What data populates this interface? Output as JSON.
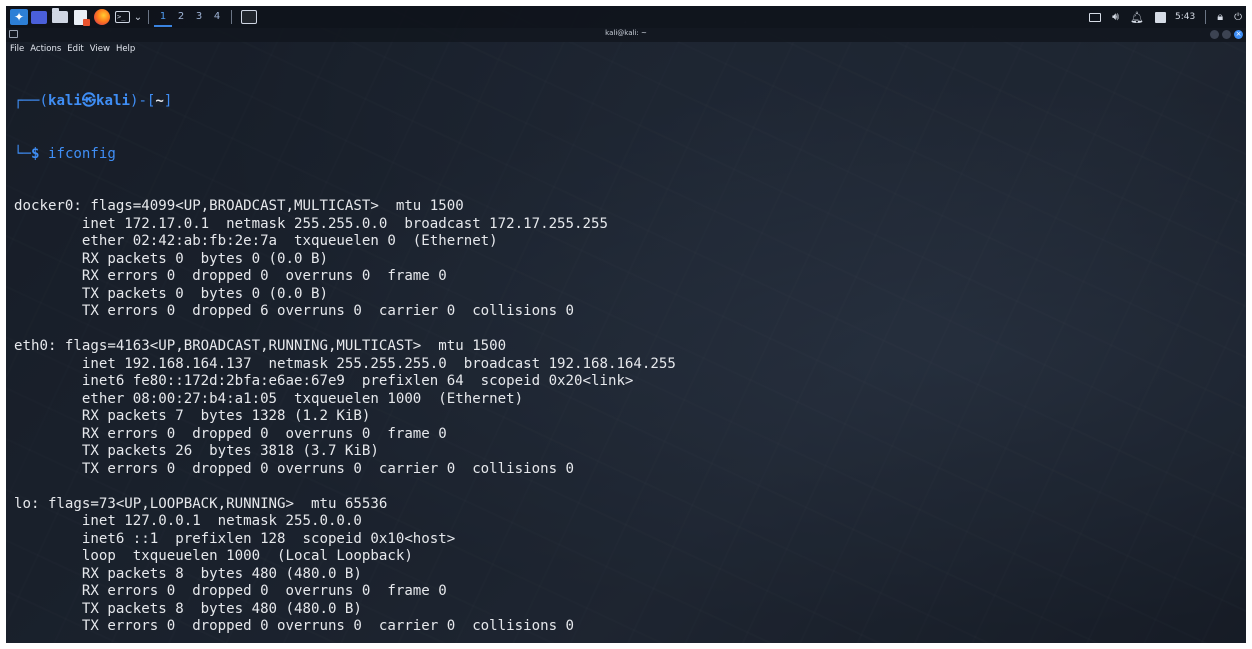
{
  "panel": {
    "workspaces": [
      {
        "label": "1",
        "active": true
      },
      {
        "label": "2",
        "active": false
      },
      {
        "label": "3",
        "active": false
      },
      {
        "label": "4",
        "active": false
      }
    ],
    "clock": "5:43"
  },
  "window": {
    "title": "kali@kali: ~",
    "menu": [
      "File",
      "Actions",
      "Edit",
      "View",
      "Help"
    ]
  },
  "prompt": {
    "user": "kali",
    "host": "kali",
    "dir": "~",
    "command": "ifconfig"
  },
  "output_lines": [
    "docker0: flags=4099<UP,BROADCAST,MULTICAST>  mtu 1500",
    "        inet 172.17.0.1  netmask 255.255.0.0  broadcast 172.17.255.255",
    "        ether 02:42:ab:fb:2e:7a  txqueuelen 0  (Ethernet)",
    "        RX packets 0  bytes 0 (0.0 B)",
    "        RX errors 0  dropped 0  overruns 0  frame 0",
    "        TX packets 0  bytes 0 (0.0 B)",
    "        TX errors 0  dropped 6 overruns 0  carrier 0  collisions 0",
    "",
    "eth0: flags=4163<UP,BROADCAST,RUNNING,MULTICAST>  mtu 1500",
    "        inet 192.168.164.137  netmask 255.255.255.0  broadcast 192.168.164.255",
    "        inet6 fe80::172d:2bfa:e6ae:67e9  prefixlen 64  scopeid 0x20<link>",
    "        ether 08:00:27:b4:a1:05  txqueuelen 1000  (Ethernet)",
    "        RX packets 7  bytes 1328 (1.2 KiB)",
    "        RX errors 0  dropped 0  overruns 0  frame 0",
    "        TX packets 26  bytes 3818 (3.7 KiB)",
    "        TX errors 0  dropped 0 overruns 0  carrier 0  collisions 0",
    "",
    "lo: flags=73<UP,LOOPBACK,RUNNING>  mtu 65536",
    "        inet 127.0.0.1  netmask 255.0.0.0",
    "        inet6 ::1  prefixlen 128  scopeid 0x10<host>",
    "        loop  txqueuelen 1000  (Local Loopback)",
    "        RX packets 8  bytes 480 (480.0 B)",
    "        RX errors 0  dropped 0  overruns 0  frame 0",
    "        TX packets 8  bytes 480 (480.0 B)",
    "        TX errors 0  dropped 0 overruns 0  carrier 0  collisions 0"
  ]
}
